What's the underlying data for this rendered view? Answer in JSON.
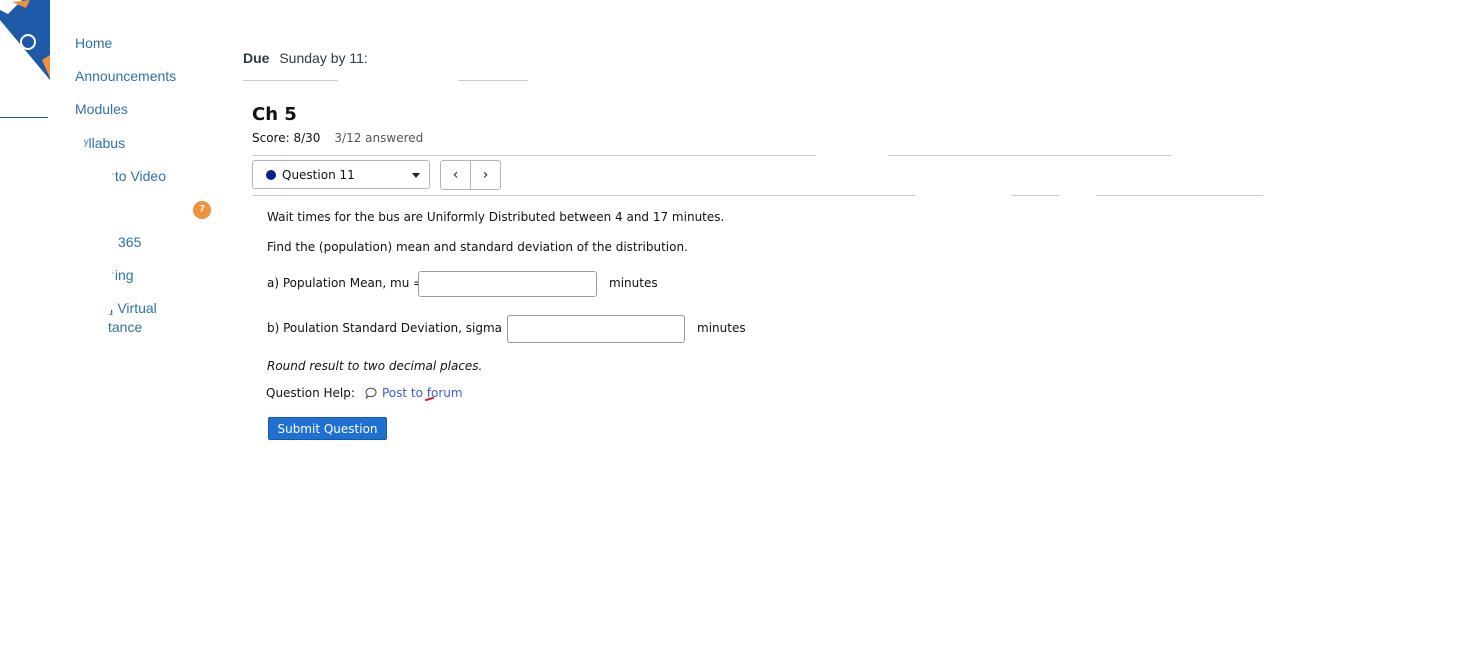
{
  "colors": {
    "nav_link": "#2d72a8",
    "badge": "#f0913e",
    "logo_blue": "#1e5aa8",
    "logo_orange": "#f0913e",
    "question_dot": "#0c1e8c",
    "link": "#3c5ad6",
    "submit_bg": "#1e70d2"
  },
  "sidebar": {
    "items": [
      {
        "label": "Home"
      },
      {
        "label": "Announcements"
      },
      {
        "label": "Modules"
      },
      {
        "label": "ʸllabus"
      },
      {
        "label": "ˑto Video"
      },
      {
        "label": "365"
      },
      {
        "label": "ˑing"
      },
      {
        "label": "⸥ Virtual"
      },
      {
        "label": "tance"
      }
    ],
    "badge_count": "7"
  },
  "due": {
    "label": "Due",
    "value": "Sunday by 11:"
  },
  "assignment": {
    "title": "Ch 5",
    "score": "Score: 8/30",
    "answered": "3/12 answered"
  },
  "question_nav": {
    "selected": "Question 11",
    "prev_icon": "chevron-left-icon",
    "next_icon": "chevron-right-icon",
    "prev_symbol": "‹",
    "next_symbol": "›"
  },
  "question": {
    "stem": "Wait times for the bus are Uniformly Distributed between 4 and 17 minutes.",
    "instruction": "Find the (population) mean and standard deviation of the distribution.",
    "part_a_label": "a) Population Mean, mu =",
    "part_a_value": "",
    "part_a_unit": "minutes",
    "part_b_label": "b) Poulation Standard Deviation, sigma =",
    "part_b_value": "",
    "part_b_unit": "minutes",
    "rounding_note": "Round result to two decimal places.",
    "help_label": "Question Help:",
    "help_link": "Post to forum",
    "help_icon": "speech-bubble-icon",
    "submit_label": "Submit Question"
  }
}
